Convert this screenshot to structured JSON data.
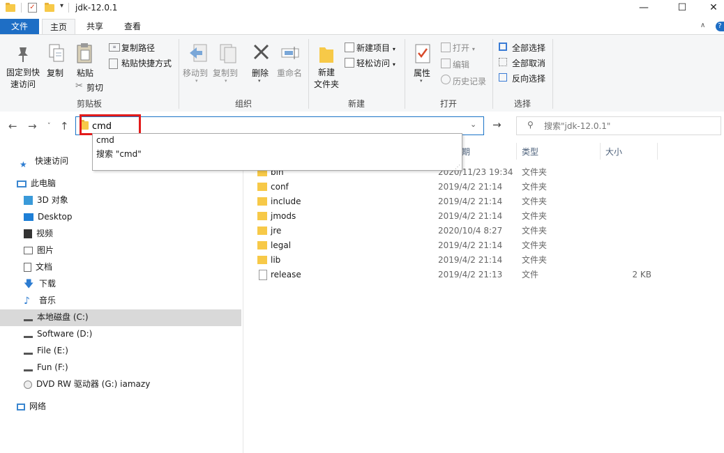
{
  "window": {
    "title": "jdk-12.0.1",
    "minimize": "—",
    "maximize": "☐",
    "close": "✕"
  },
  "ribbon_tabs": [
    "文件",
    "主页",
    "共享",
    "查看"
  ],
  "ribbon": {
    "clipboard": {
      "label": "剪贴板",
      "pin": "固定到快\n速访问",
      "pin1": "固定到快",
      "pin2": "速访问",
      "copy": "复制",
      "paste": "粘贴",
      "copy_path": "复制路径",
      "paste_shortcut": "粘贴快捷方式",
      "cut": "剪切"
    },
    "organize": {
      "label": "组织",
      "move_to": "移动到",
      "copy_to": "复制到",
      "delete": "删除",
      "rename": "重命名"
    },
    "new": {
      "label": "新建",
      "new_folder1": "新建",
      "new_folder2": "文件夹",
      "new_item": "新建项目",
      "easy_access": "轻松访问"
    },
    "open": {
      "label": "打开",
      "properties": "属性",
      "open": "打开",
      "edit": "编辑",
      "history": "历史记录"
    },
    "select": {
      "label": "选择",
      "select_all": "全部选择",
      "select_none": "全部取消",
      "invert": "反向选择"
    }
  },
  "address": {
    "value": "cmd"
  },
  "search": {
    "placeholder": "搜索\"jdk-12.0.1\""
  },
  "autocomplete": [
    "cmd",
    "搜索 \"cmd\""
  ],
  "nav": {
    "quick_access": "快速访问",
    "this_pc": "此电脑",
    "items": [
      "3D 对象",
      "Desktop",
      "视频",
      "图片",
      "文档",
      "下载",
      "音乐",
      "本地磁盘 (C:)",
      "Software (D:)",
      "File (E:)",
      "Fun (F:)",
      "DVD RW 驱动器 (G:) iamazy"
    ],
    "network": "网络"
  },
  "columns": {
    "date": "期",
    "type": "类型",
    "size": "大小"
  },
  "files": [
    {
      "name": "bin",
      "date": "2020/11/23 19:34",
      "type": "文件夹",
      "size": ""
    },
    {
      "name": "conf",
      "date": "2019/4/2 21:14",
      "type": "文件夹",
      "size": ""
    },
    {
      "name": "include",
      "date": "2019/4/2 21:14",
      "type": "文件夹",
      "size": ""
    },
    {
      "name": "jmods",
      "date": "2019/4/2 21:14",
      "type": "文件夹",
      "size": ""
    },
    {
      "name": "jre",
      "date": "2020/10/4 8:27",
      "type": "文件夹",
      "size": ""
    },
    {
      "name": "legal",
      "date": "2019/4/2 21:14",
      "type": "文件夹",
      "size": ""
    },
    {
      "name": "lib",
      "date": "2019/4/2 21:14",
      "type": "文件夹",
      "size": ""
    },
    {
      "name": "release",
      "date": "2019/4/2 21:13",
      "type": "文件",
      "size": "2 KB"
    }
  ],
  "colors": {
    "accent": "#1e6ec5",
    "highlight": "#e21b1b",
    "folder": "#f7c948"
  }
}
